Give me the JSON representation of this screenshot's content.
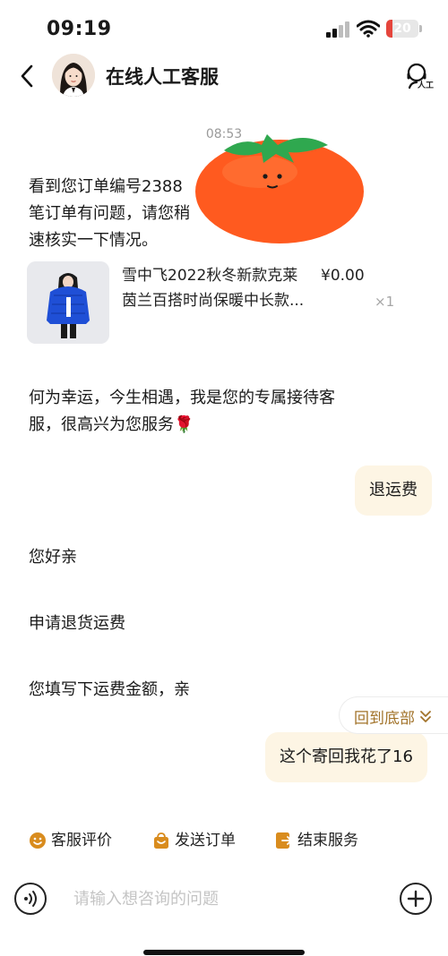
{
  "status_bar": {
    "time": "09:19",
    "battery_level": "20",
    "battery_fraction": 0.2
  },
  "header": {
    "title": "在线人工客服",
    "back_icon": "chevron-left-icon",
    "avatar_icon": "avatar-icon",
    "human_agent_icon": "headset-person-icon",
    "human_agent_label": "人工"
  },
  "chat": {
    "timestamp": "08:53",
    "order_notice": {
      "lines": [
        "看到您订单编号2388",
        "笔订单有问题，请您稍",
        "速核实一下情况。"
      ]
    },
    "order_card": {
      "title_line1": "雪中飞2022秋冬新款克莱",
      "title_line2": "茵兰百搭时尚保暖中长款...",
      "price": "¥0.00",
      "quantity": "×1",
      "image_icon": "blue-down-jacket-image"
    },
    "greeting": {
      "line1": "何为幸运，今生相遇，我是您的专属接待客",
      "line2": "服，很高兴为您服务🌹"
    },
    "user_msg_1": "退运费",
    "agent_msg_1": "您好亲",
    "agent_msg_2": "申请退货运费",
    "agent_msg_3": "您填写下运费金额，亲",
    "user_msg_2": "这个寄回我花了16",
    "sticker_icon": "tomato-sticker"
  },
  "scroll_to_bottom": {
    "label": "回到底部",
    "icon": "double-chevron-down-icon"
  },
  "quick_actions": [
    {
      "label": "客服评价",
      "icon": "smiley-icon"
    },
    {
      "label": "发送订单",
      "icon": "shopping-bag-icon"
    },
    {
      "label": "结束服务",
      "icon": "exit-icon"
    }
  ],
  "input": {
    "placeholder": "请输入想咨询的问题",
    "voice_icon": "voice-icon",
    "plus_icon": "plus-circle-icon"
  },
  "colors": {
    "accent_gold": "#a2732a",
    "user_bubble": "#fdf5e4",
    "action_icon": "#d98c1e",
    "battery_red": "#e5453c",
    "tomato": "#ff5a1f"
  }
}
